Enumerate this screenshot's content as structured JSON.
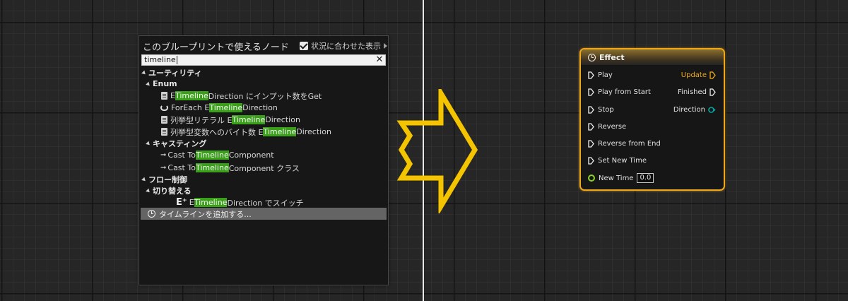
{
  "menu": {
    "title": "このブループリントで使えるノード",
    "context_sensitive_label": "状況に合わせた表示",
    "context_sensitive_checked": true,
    "search": {
      "value": "timeline"
    },
    "rows": {
      "utility": "ユーティリティ",
      "enum": "Enum",
      "enum_item1": {
        "pre": "E",
        "hl": "Timeline",
        "post": "Direction にインプット数をGet"
      },
      "enum_item2": {
        "pre": "ForEach E",
        "hl": "Timeline",
        "post": "Direction"
      },
      "enum_item3": {
        "pre": "列挙型リテラル E",
        "hl": "Timeline",
        "post": "Direction"
      },
      "enum_item4": {
        "pre": "列挙型変数へのバイト数 E",
        "hl": "Timeline",
        "post": "Direction"
      },
      "casting": "キャスティング",
      "cast_item1": {
        "pre": "Cast To ",
        "hl": "Timeline",
        "post": "Component"
      },
      "cast_item2": {
        "pre": "Cast To ",
        "hl": "Timeline",
        "post": "Component クラス"
      },
      "flow_control": "フロー制御",
      "switch": "切り替える",
      "switch_item": {
        "pre": "E",
        "hl": "Timeline",
        "post": "Direction でスイッチ"
      },
      "add_timeline": "タイムラインを追加する..."
    }
  },
  "node": {
    "title": "Effect",
    "inputs": {
      "play": "Play",
      "play_from_start": "Play from Start",
      "stop": "Stop",
      "reverse": "Reverse",
      "reverse_from_end": "Reverse from End",
      "set_new_time": "Set New Time",
      "new_time": "New Time",
      "new_time_value": "0.0"
    },
    "outputs": {
      "update": "Update",
      "finished": "Finished",
      "direction": "Direction"
    }
  },
  "colors": {
    "node_border": "#f0a818",
    "highlight": "#3aa01a",
    "arrow": "#f5c400",
    "float_pin": "#8ad42a",
    "enum_pin": "#00a8a0"
  }
}
